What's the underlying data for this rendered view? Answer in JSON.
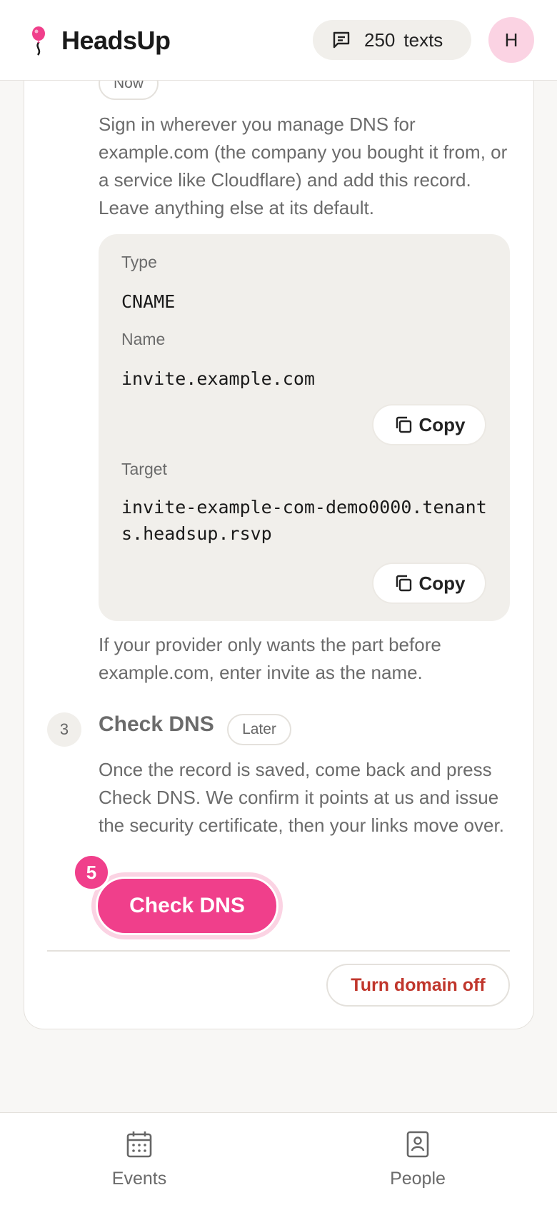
{
  "header": {
    "brand": "HeadsUp",
    "credits_count": "250",
    "credits_unit": "texts",
    "avatar_initial": "H"
  },
  "step2": {
    "badge": "Now",
    "instructions": "Sign in wherever you manage DNS for example.com (the company you bought it from, or a service like Cloudflare) and add this record. Leave anything else at its default.",
    "record": {
      "type_label": "Type",
      "type_value": "CNAME",
      "name_label": "Name",
      "name_value": "invite.example.com",
      "target_label": "Target",
      "target_value": "invite-example-com-demo0000.tenants.headsup.rsvp",
      "copy_label": "Copy"
    },
    "note": "If your provider only wants the part before example.com, enter invite as the name."
  },
  "step3": {
    "number": "3",
    "title": "Check DNS",
    "badge": "Later",
    "description": "Once the record is saved, come back and press Check DNS. We confirm it points at us and issue the security certificate, then your links move over.",
    "button_label": "Check DNS",
    "marker": "5"
  },
  "actions": {
    "turn_off_label": "Turn domain off"
  },
  "nav": {
    "events_label": "Events",
    "people_label": "People"
  },
  "colors": {
    "accent": "#f03f8b",
    "danger": "#c0362c"
  }
}
